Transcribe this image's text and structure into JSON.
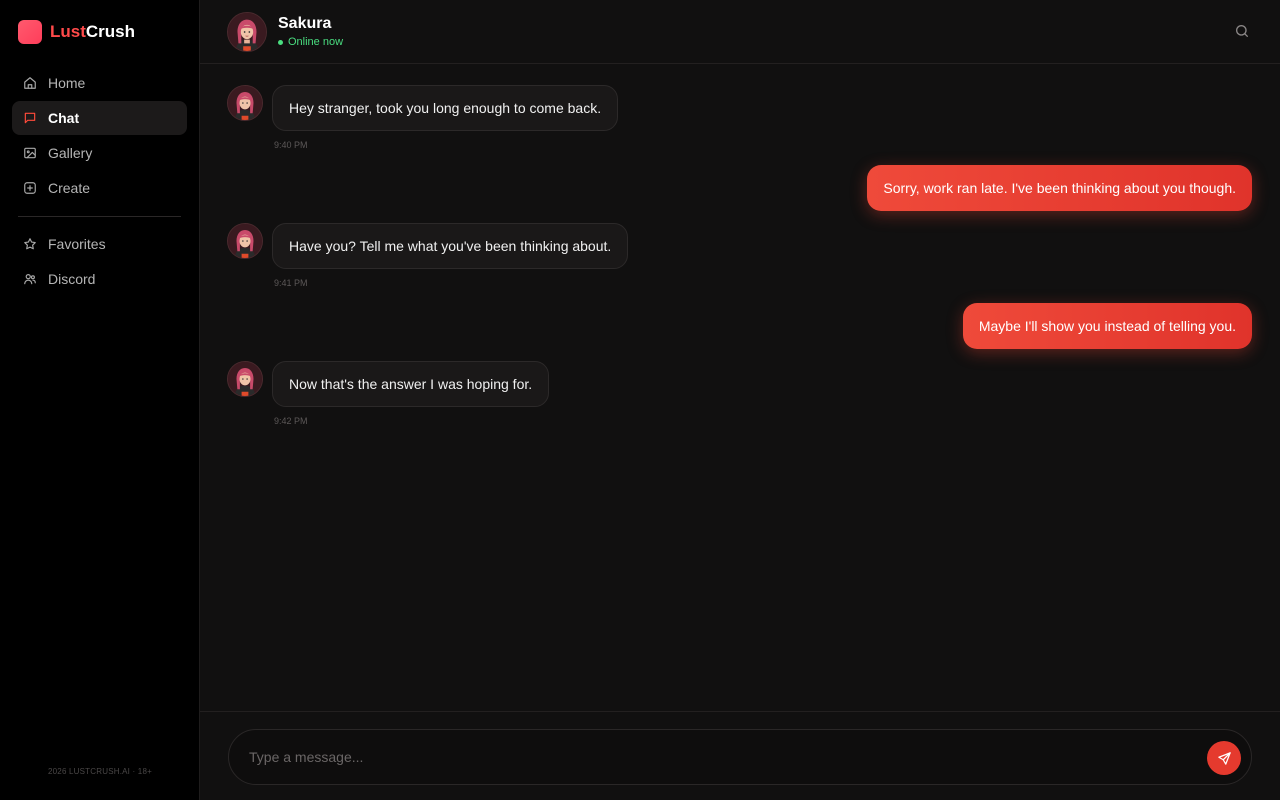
{
  "brand": {
    "name_part1": "Lust",
    "name_part2": "Crush",
    "accent": "#ff4a4a"
  },
  "nav": {
    "items": [
      {
        "label": "Home",
        "icon": "home-icon"
      },
      {
        "label": "Chat",
        "icon": "chat-icon",
        "active": true
      },
      {
        "label": "Gallery",
        "icon": "image-icon"
      },
      {
        "label": "Create",
        "icon": "plus-square-icon"
      }
    ],
    "secondary": [
      {
        "label": "Favorites",
        "icon": "star-icon"
      },
      {
        "label": "Discord",
        "icon": "users-icon"
      }
    ]
  },
  "footer": {
    "text": "2026 LUSTCRUSH.AI · 18+"
  },
  "header": {
    "name": "Sakura",
    "status": "Online now",
    "status_color": "#4ade80"
  },
  "messages": [
    {
      "from": "bot",
      "text": "Hey stranger, took you long enough to come back.",
      "time": "9:40 PM"
    },
    {
      "from": "user",
      "text": "Sorry, work ran late. I've been thinking about you though."
    },
    {
      "from": "bot",
      "text": "Have you? Tell me what you've been thinking about.",
      "time": "9:41 PM"
    },
    {
      "from": "user",
      "text": "Maybe I'll show you instead of telling you."
    },
    {
      "from": "bot",
      "text": "Now that's the answer I was hoping for.",
      "time": "9:42 PM"
    }
  ],
  "composer": {
    "placeholder": "Type a message..."
  }
}
